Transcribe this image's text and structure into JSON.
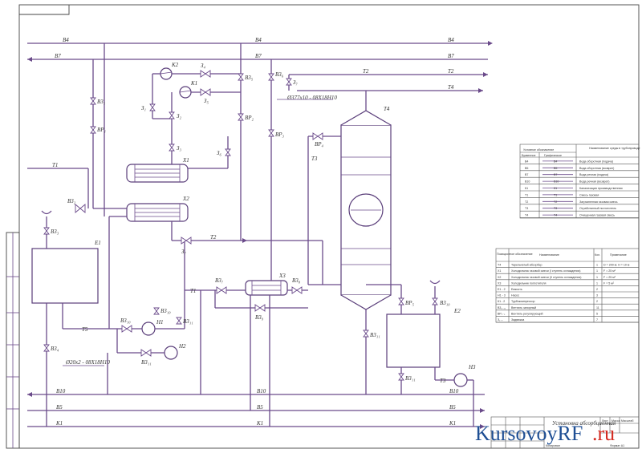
{
  "lines": {
    "top": [
      "В4",
      "В4",
      "В4"
    ],
    "second": [
      "В7",
      "В7",
      "В7"
    ],
    "third": [
      "Т2",
      "Т2"
    ],
    "fourth": [
      "Т4"
    ],
    "bottom1": [
      "В10",
      "В10",
      "В10"
    ],
    "bottom2": [
      "В5",
      "В5",
      "В5"
    ],
    "bottom3": [
      "К1",
      "К1",
      "К1"
    ]
  },
  "equipment": {
    "tower": "Т4",
    "hx1": "Х1",
    "hx2": "Х2",
    "hx3": "Х3",
    "tank1": "Е1",
    "tank2": "Е2",
    "pump1": "К1",
    "pump2": "К2",
    "pump3": "Н1",
    "pump4": "Н2",
    "pump5": "Н3"
  },
  "valves": [
    "В3₁",
    "В3₂",
    "В3₃",
    "В3₄",
    "В3₅",
    "В3₆",
    "В3₇",
    "В3₈",
    "В3₉",
    "В3₁₀",
    "В3₁₁",
    "З₁",
    "З₂",
    "З₃",
    "З₄",
    "З₅",
    "З₆",
    "З₇",
    "ВР₁",
    "ВР₂",
    "ВР₃",
    "ВР₄",
    "ВР₅"
  ],
  "pipe_labels": {
    "p1": "Ø377х10 - 08Х18Н10",
    "p2": "Ø20х2 - 08Х18Н10",
    "line_t1": "Т1",
    "line_t2": "Т2",
    "line_t3": "Т3",
    "line_t4": "Т4",
    "line_t5": "Т5"
  },
  "legend": {
    "title_left": "Условное обозначение",
    "title_right": "Наименование среды в трубопроводе",
    "col_a": "Буквенное",
    "col_b": "Графическое",
    "rows": [
      {
        "code": "В4",
        "name": "Вода оборотная (подача)"
      },
      {
        "code": "В5",
        "name": "Вода оборотная (возврат)"
      },
      {
        "code": "В7",
        "name": "Вода речная (подача)"
      },
      {
        "code": "В10",
        "name": "Вода речная (возврат)"
      },
      {
        "code": "К1",
        "name": "Канализация производственная"
      },
      {
        "code": "Т1",
        "name": "Смесь газовая"
      },
      {
        "code": "Т2",
        "name": "Загрязненная газовая смесь"
      },
      {
        "code": "Т3",
        "name": "Отработанный поглотитель"
      },
      {
        "code": "Т4",
        "name": "Очищенная газовая смесь"
      }
    ]
  },
  "spec": {
    "headers": [
      "Позиционное обозначение",
      "Наименование",
      "Кол.",
      "Примечание"
    ],
    "rows": [
      {
        "pos": "Т4",
        "name": "Тарельчатый абсорбер",
        "qty": "1",
        "note": "D = 200 м; Н = 10 м"
      },
      {
        "pos": "Х1",
        "name": "Холодильник газовой смеси (I ступень охлаждения)",
        "qty": "1",
        "note": "F = 25 м²"
      },
      {
        "pos": "Х2",
        "name": "Холодильник газовой смеси (II ступень охлаждения)",
        "qty": "1",
        "note": "F = 25 м²"
      },
      {
        "pos": "Х3",
        "name": "Холодильник поглотителя",
        "qty": "1",
        "note": "F = 5 м²"
      },
      {
        "pos": "Е1 - 2",
        "name": "Емкость",
        "qty": "2",
        "note": ""
      },
      {
        "pos": "Н1 - 3",
        "name": "Насос",
        "qty": "3",
        "note": ""
      },
      {
        "pos": "К1 - 2",
        "name": "Турбокомпрессор",
        "qty": "2",
        "note": ""
      },
      {
        "pos": "В3₁₋₁₁",
        "name": "Вентиль запорный",
        "qty": "11",
        "note": ""
      },
      {
        "pos": "ВР₁₋₅",
        "name": "Вентиль регулирующий",
        "qty": "5",
        "note": ""
      },
      {
        "pos": "З₁₋₇",
        "name": "Задвижка",
        "qty": "7",
        "note": ""
      }
    ]
  },
  "title_block": {
    "name": "Установка абсорбционная",
    "sheet": "Лист",
    "sheets": "Листов",
    "mass": "Масса",
    "scale": "Масштаб",
    "copied": "Копировал",
    "format": "Формат А1"
  },
  "watermark": {
    "main": "KursovoyRF",
    "suffix": ".ru"
  },
  "colors": {
    "line": "#6a4a8a",
    "frame": "#444444",
    "watermark_blue": "#1f4f94",
    "watermark_red": "#d42a20"
  }
}
